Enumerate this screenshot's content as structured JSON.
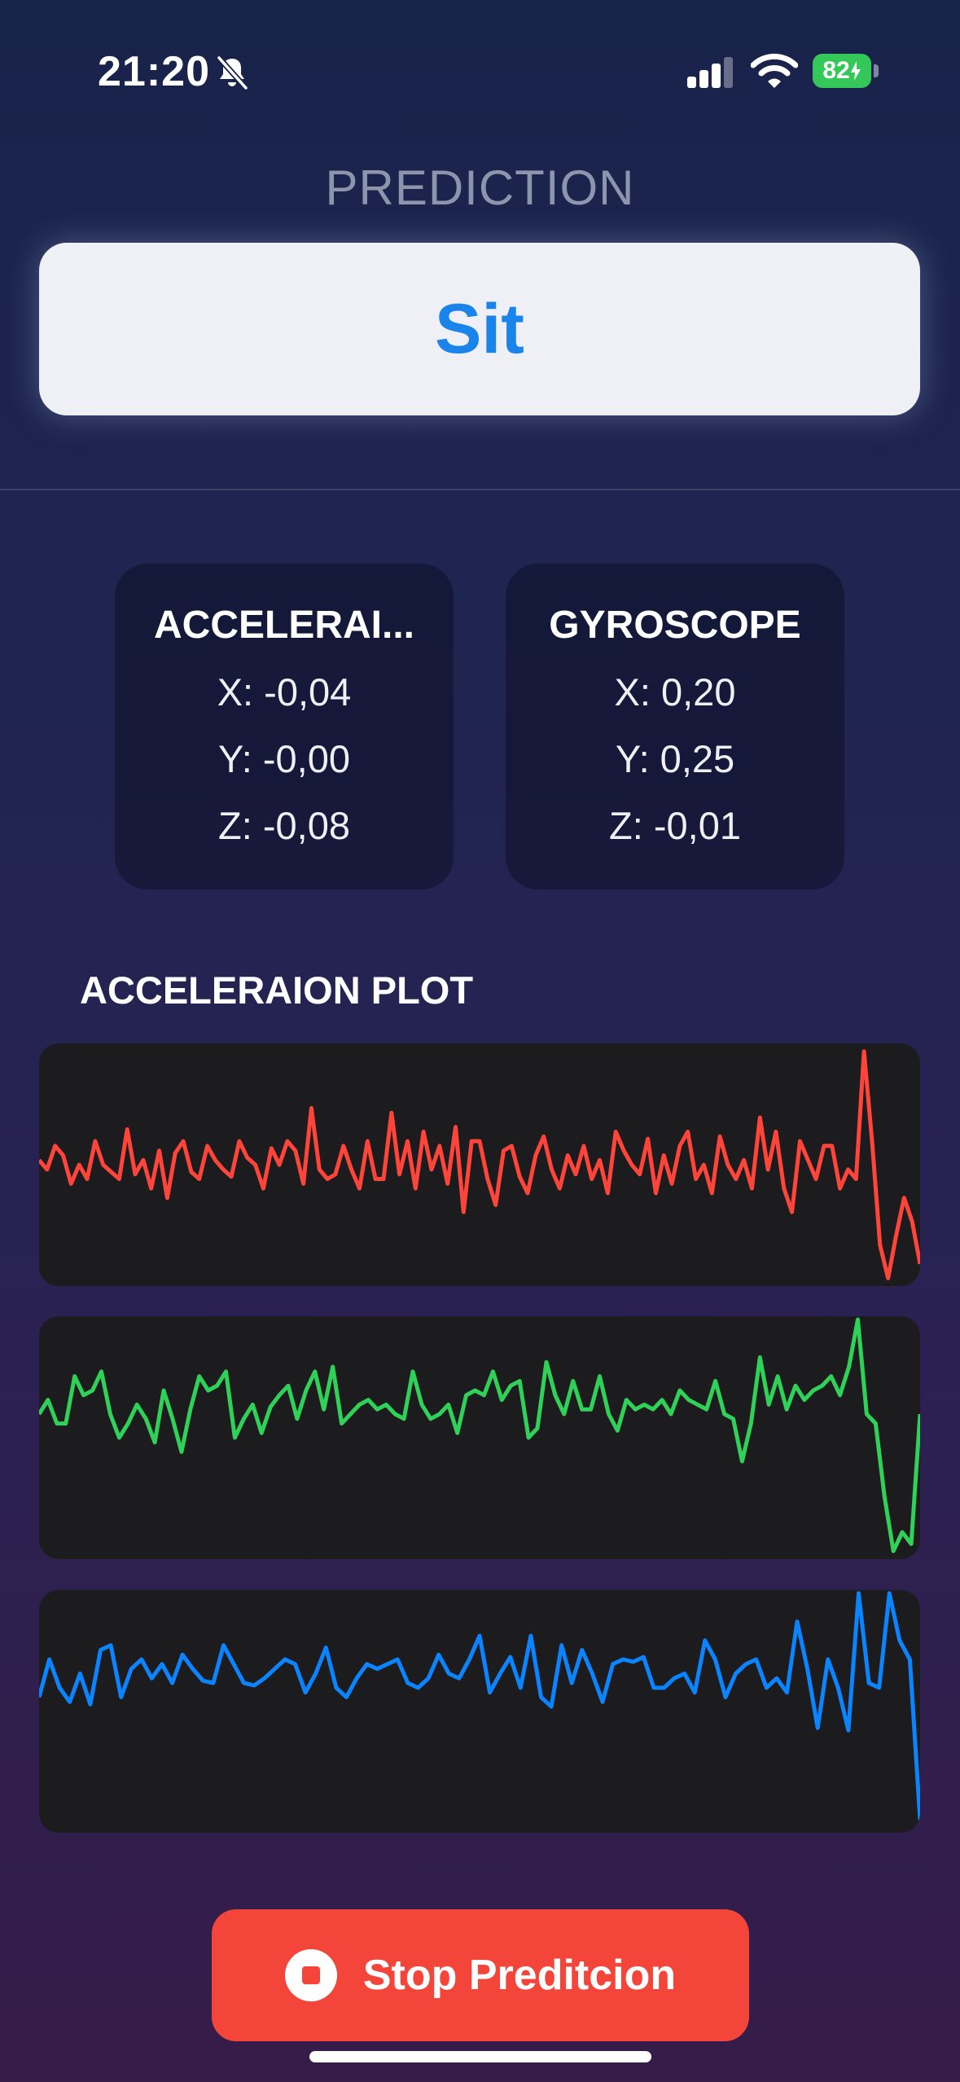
{
  "status_bar": {
    "time": "21:20",
    "battery": "82",
    "icons": [
      "bell-slash-icon",
      "cellular-signal-icon",
      "wifi-icon",
      "battery-charging-icon"
    ]
  },
  "prediction": {
    "label": "PREDICTION",
    "value": "Sit"
  },
  "accelerometer": {
    "title": "ACCELERAI...",
    "x": "X: -0,04",
    "y": "Y: -0,00",
    "z": "Z: -0,08"
  },
  "gyroscope": {
    "title": "GYROSCOPE",
    "x": "X: 0,20",
    "y": "Y: 0,25",
    "z": "Z: -0,01"
  },
  "plot": {
    "heading": "ACCELERAION PLOT",
    "series": [
      {
        "axis": "x",
        "color": "#ff453a",
        "values": [
          0.52,
          0.48,
          0.58,
          0.54,
          0.42,
          0.5,
          0.44,
          0.6,
          0.5,
          0.47,
          0.44,
          0.65,
          0.46,
          0.52,
          0.4,
          0.56,
          0.36,
          0.55,
          0.6,
          0.47,
          0.44,
          0.58,
          0.52,
          0.48,
          0.45,
          0.6,
          0.53,
          0.5,
          0.4,
          0.57,
          0.5,
          0.6,
          0.56,
          0.42,
          0.74,
          0.48,
          0.44,
          0.46,
          0.58,
          0.48,
          0.4,
          0.6,
          0.44,
          0.44,
          0.72,
          0.46,
          0.6,
          0.4,
          0.64,
          0.48,
          0.58,
          0.42,
          0.66,
          0.3,
          0.6,
          0.6,
          0.44,
          0.33,
          0.56,
          0.58,
          0.45,
          0.38,
          0.54,
          0.62,
          0.48,
          0.4,
          0.54,
          0.46,
          0.58,
          0.44,
          0.52,
          0.38,
          0.64,
          0.56,
          0.5,
          0.46,
          0.61,
          0.38,
          0.54,
          0.42,
          0.58,
          0.64,
          0.44,
          0.5,
          0.38,
          0.62,
          0.5,
          0.44,
          0.52,
          0.4,
          0.7,
          0.48,
          0.64,
          0.4,
          0.3,
          0.6,
          0.52,
          0.44,
          0.58,
          0.58,
          0.4,
          0.48,
          0.44,
          0.98,
          0.6,
          0.16,
          0.02,
          0.2,
          0.36,
          0.26,
          0.08
        ]
      },
      {
        "axis": "y",
        "color": "#30d158",
        "values": [
          0.6,
          0.66,
          0.56,
          0.56,
          0.76,
          0.68,
          0.7,
          0.78,
          0.6,
          0.5,
          0.56,
          0.64,
          0.58,
          0.48,
          0.7,
          0.58,
          0.44,
          0.62,
          0.76,
          0.7,
          0.72,
          0.78,
          0.5,
          0.58,
          0.64,
          0.52,
          0.63,
          0.68,
          0.72,
          0.58,
          0.7,
          0.78,
          0.62,
          0.8,
          0.56,
          0.6,
          0.64,
          0.66,
          0.62,
          0.64,
          0.6,
          0.58,
          0.78,
          0.64,
          0.58,
          0.6,
          0.64,
          0.52,
          0.68,
          0.7,
          0.68,
          0.78,
          0.66,
          0.72,
          0.74,
          0.5,
          0.54,
          0.82,
          0.68,
          0.6,
          0.74,
          0.62,
          0.62,
          0.76,
          0.6,
          0.53,
          0.66,
          0.62,
          0.64,
          0.62,
          0.66,
          0.6,
          0.7,
          0.66,
          0.64,
          0.62,
          0.74,
          0.6,
          0.58,
          0.4,
          0.56,
          0.84,
          0.64,
          0.76,
          0.62,
          0.72,
          0.66,
          0.7,
          0.72,
          0.76,
          0.68,
          0.8,
          1.0,
          0.6,
          0.56,
          0.25,
          0.02,
          0.1,
          0.05,
          0.6
        ]
      },
      {
        "axis": "z",
        "color": "#0a84ff",
        "values": [
          0.56,
          0.72,
          0.6,
          0.54,
          0.66,
          0.53,
          0.76,
          0.78,
          0.56,
          0.68,
          0.72,
          0.64,
          0.7,
          0.62,
          0.74,
          0.68,
          0.63,
          0.62,
          0.78,
          0.7,
          0.62,
          0.61,
          0.64,
          0.68,
          0.72,
          0.7,
          0.58,
          0.66,
          0.77,
          0.6,
          0.56,
          0.64,
          0.7,
          0.68,
          0.7,
          0.72,
          0.62,
          0.6,
          0.64,
          0.74,
          0.66,
          0.64,
          0.72,
          0.82,
          0.58,
          0.66,
          0.73,
          0.6,
          0.82,
          0.56,
          0.52,
          0.78,
          0.62,
          0.76,
          0.66,
          0.54,
          0.7,
          0.72,
          0.71,
          0.73,
          0.6,
          0.6,
          0.64,
          0.66,
          0.58,
          0.8,
          0.72,
          0.56,
          0.66,
          0.7,
          0.72,
          0.6,
          0.64,
          0.58,
          0.88,
          0.68,
          0.43,
          0.72,
          0.6,
          0.42,
          1.0,
          0.62,
          0.6,
          1.0,
          0.8,
          0.72,
          0.04
        ]
      }
    ]
  },
  "stop_button": {
    "label": "Stop Preditcion"
  }
}
